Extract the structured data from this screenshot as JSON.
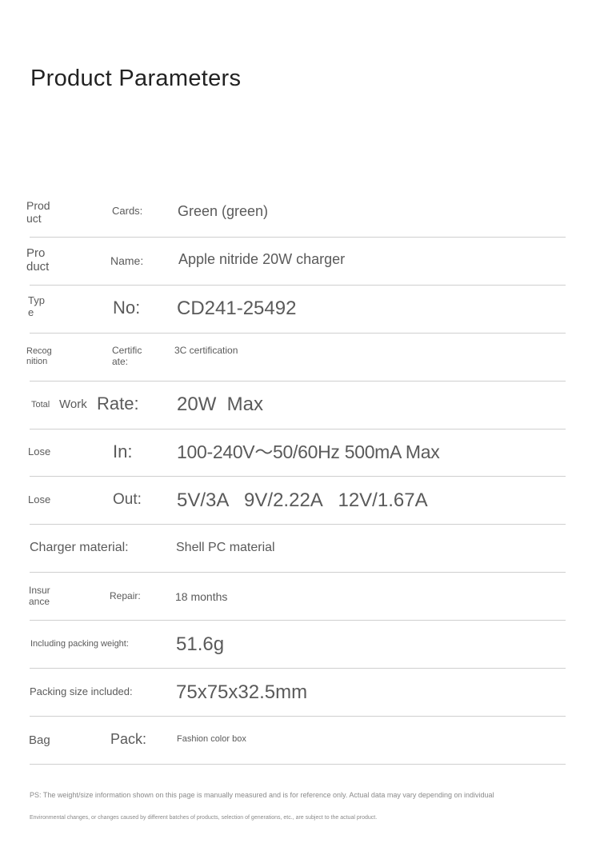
{
  "title": "Product Parameters",
  "rows": [
    {
      "label1": "Prod uct",
      "label2": "Cards:",
      "value": "Green (green)"
    },
    {
      "label1": "Pro duct",
      "label2": "Name:",
      "value": "Apple nitride 20W charger"
    },
    {
      "label1": "Typ e",
      "label2": "No:",
      "value": "CD241-25492"
    },
    {
      "label1": "Recog nition",
      "label2": "Certific ate:",
      "value": "3C certification"
    },
    {
      "label1a": "Total",
      "label1b": "Work",
      "label2": "Rate:",
      "value": "20W  Max"
    },
    {
      "label1": "Lose",
      "label2": "In:",
      "value": "100-240V～50/60Hz 500mA Max"
    },
    {
      "label1": "Lose",
      "label2": "Out:",
      "value": "5V/3A   9V/2.22A   12V/1.67A"
    },
    {
      "label1": "Charger material:",
      "value": "Shell PC material"
    },
    {
      "label1": "Insur ance",
      "label2": "Repair:",
      "value": "18 months"
    },
    {
      "label1": "Including packing weight:",
      "value": "51.6g"
    },
    {
      "label1": "Packing size included:",
      "value": "75x75x32.5mm"
    },
    {
      "label1": "Bag",
      "label2": "Pack:",
      "value": "Fashion color box"
    }
  ],
  "notes": [
    "PS: The weight/size information shown on this page is manually measured and is for reference only. Actual data may vary depending on individual",
    "Environmental changes, or changes caused by different batches of products, selection of generations, etc., are subject to the actual product."
  ]
}
